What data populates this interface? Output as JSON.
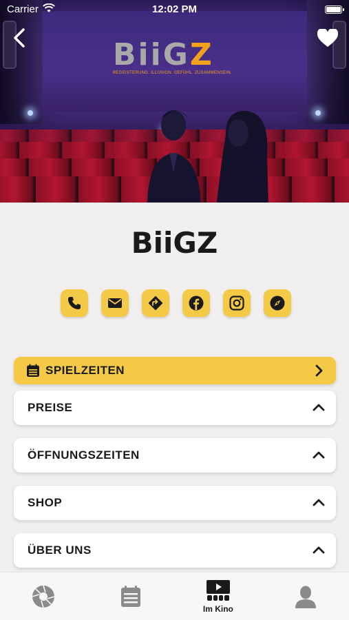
{
  "status_bar": {
    "carrier": "Carrier",
    "time": "12:02 PM"
  },
  "hero": {
    "logo_part1": "BiiG",
    "logo_part2": "Z",
    "tagline": "BEGEISTERUNG. ILLUSION. GEFÜHL. ZUSAMMENSEIN."
  },
  "header_icons": {
    "back": "chevron-left-icon",
    "favorite": "heart-icon"
  },
  "title": "BiiGZ",
  "contact_icons": [
    "phone-icon",
    "mail-icon",
    "directions-icon",
    "facebook-icon",
    "instagram-icon",
    "compass-icon"
  ],
  "sections": {
    "spielzeiten": "SPIELZEITEN",
    "preise": "PREISE",
    "oeffnungszeiten": "ÖFFNUNGSZEITEN",
    "shop": "SHOP",
    "ueber_uns": "ÜBER UNS"
  },
  "tabbar": {
    "tab1_icon": "shutter-icon",
    "tab2_icon": "calendar-list-icon",
    "tab3_icon": "cinema-play-icon",
    "tab3_label": "Im Kino",
    "tab4_icon": "profile-icon"
  },
  "colors": {
    "accent": "#f4c946",
    "background": "#f1efed",
    "logo_orange": "#f2a11a"
  }
}
